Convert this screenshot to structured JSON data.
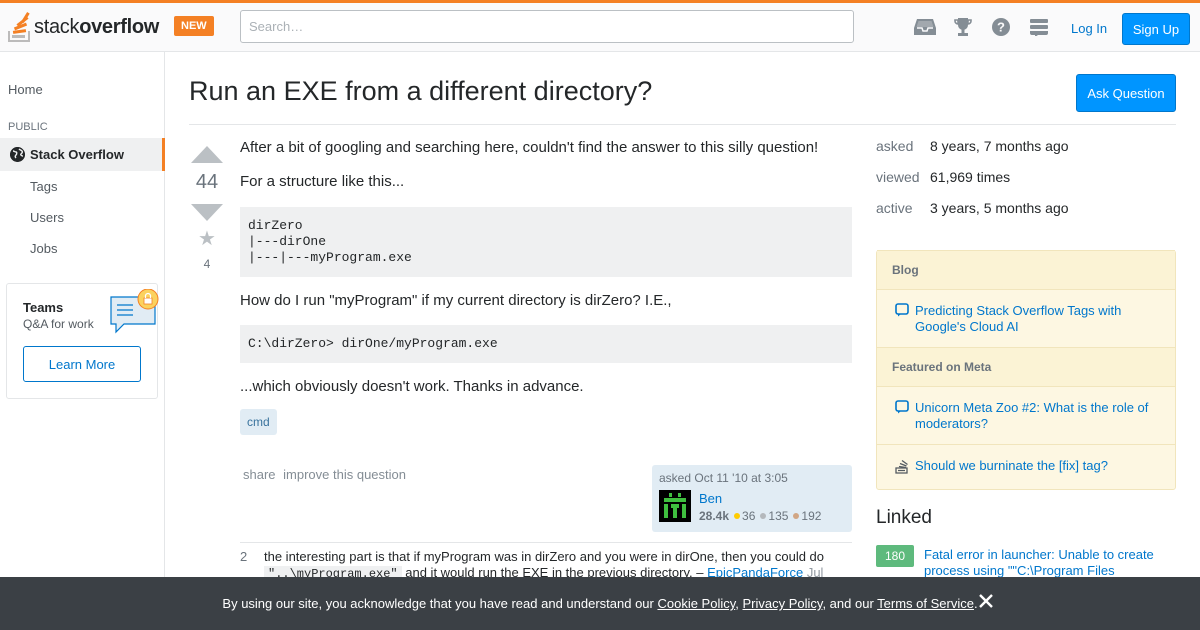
{
  "header": {
    "logo_text_light": "stack",
    "logo_text_bold": "overflow",
    "new_badge": "NEW",
    "search_placeholder": "Search…",
    "login": "Log In",
    "signup": "Sign Up",
    "icons": [
      "inbox-icon",
      "achievements-icon",
      "help-icon",
      "site-switcher-icon"
    ]
  },
  "sidebar": {
    "home": "Home",
    "section": "PUBLIC",
    "current_site": "Stack Overflow",
    "items": [
      {
        "label": "Tags"
      },
      {
        "label": "Users"
      },
      {
        "label": "Jobs"
      }
    ],
    "teams": {
      "title": "Teams",
      "subtitle": "Q&A for work",
      "button": "Learn More"
    }
  },
  "question": {
    "title": "Run an EXE from a different directory?",
    "ask_button": "Ask Question",
    "votes": "44",
    "favorites": "4",
    "body": {
      "p1": "After a bit of googling and searching here, couldn't find the answer to this silly question!",
      "p2": "For a structure like this...",
      "code1": "dirZero\n|---dirOne\n|---|---myProgram.exe",
      "p3": "How do I run \"myProgram\" if my current directory is dirZero? I.E.,",
      "code2": "C:\\dirZero> dirOne/myProgram.exe",
      "p4": "...which obviously doesn't work. Thanks in advance."
    },
    "tags": [
      "cmd"
    ],
    "menu": {
      "share": "share",
      "improve": "improve this question"
    },
    "owner": {
      "asked": "asked Oct 11 '10 at 3:05",
      "name": "Ben",
      "reputation": "28.4k",
      "gold": "36",
      "silver": "135",
      "bronze": "192"
    },
    "comment": {
      "score": "2",
      "text_before": "the interesting part is that if myProgram was in dirZero and you were in dirOne, then you could do",
      "code": "\"..\\myProgram.exe\"",
      "text_after": "and it would run the EXE in the previous directory. –",
      "author": "EpicPandaForce",
      "time": "Jul"
    }
  },
  "stats": [
    {
      "label": "asked",
      "value": "8 years, 7 months ago"
    },
    {
      "label": "viewed",
      "value": "61,969 times"
    },
    {
      "label": "active",
      "value": "3 years, 5 months ago"
    }
  ],
  "widget": {
    "blog_title": "Blog",
    "blog_item": "Predicting Stack Overflow Tags with Google's Cloud AI",
    "meta_title": "Featured on Meta",
    "meta_item1": "Unicorn Meta Zoo #2: What is the role of moderators?",
    "meta_item2": "Should we burninate the [fix] tag?"
  },
  "linked": {
    "title": "Linked",
    "items": [
      {
        "score": "180",
        "title": "Fatal error in launcher: Unable to create process using \"\"C:\\Program Files"
      }
    ]
  },
  "cookie": {
    "text1": "By using our site, you acknowledge that you have read and understand our ",
    "cookie_policy": "Cookie Policy",
    "sep1": ", ",
    "privacy_policy": "Privacy Policy",
    "sep2": ", and our ",
    "terms": "Terms of Service",
    "end": "."
  },
  "colors": {
    "accent": "#f48024",
    "link": "#0077cc",
    "button": "#0095ff",
    "gold": "#ffcc01",
    "silver": "#b4b8bc",
    "bronze": "#d1a684"
  }
}
